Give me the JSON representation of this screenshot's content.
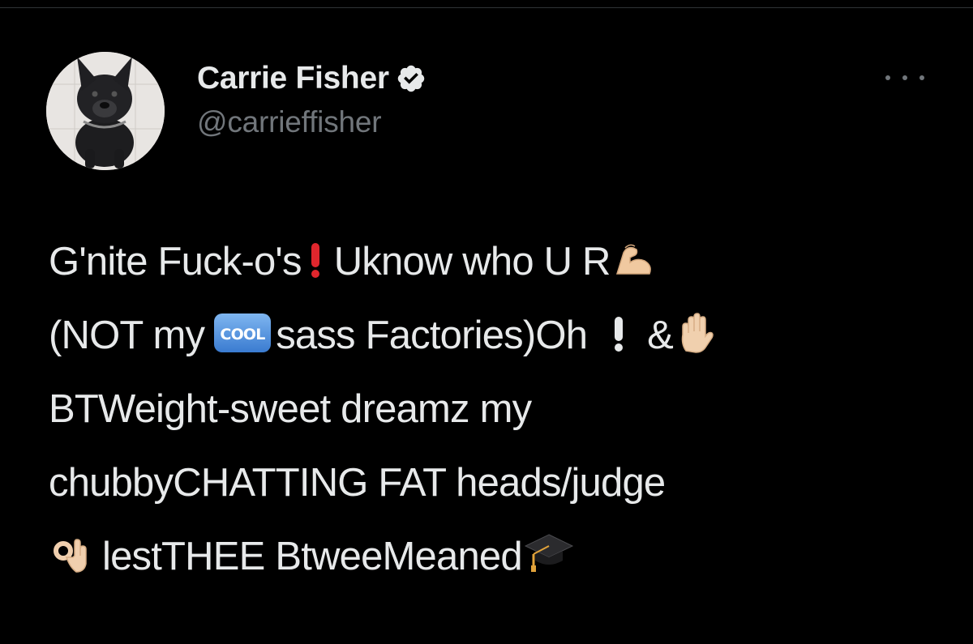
{
  "tweet": {
    "author": {
      "display_name": "Carrie Fisher",
      "handle": "@carrieffisher",
      "verified": true
    },
    "text_segments": {
      "s1": "G'nite Fuck-o's",
      "s2": "Uknow who U R",
      "s3": "(NOT my",
      "s4": "sass Factories)Oh",
      "s5": "&",
      "s6": "BTWeight-sweet dreamz my",
      "s7": "chubbyCHATTING FAT heads/judge",
      "s8": "lestTHEE BtweeMeaned"
    },
    "emoji_cool_label": "COOL",
    "icons": {
      "verified": "verified-badge-icon",
      "more": "more-options-icon",
      "exclamation": "red-exclamation-emoji",
      "white_exclamation": "white-exclamation-emoji",
      "flexed_biceps": "flexed-biceps-emoji",
      "cool": "cool-button-emoji",
      "raised_hand": "raised-hand-emoji",
      "ok_hand": "ok-hand-emoji",
      "graduation_cap": "graduation-cap-emoji"
    },
    "colors": {
      "background": "#000000",
      "text": "#e7e9ea",
      "secondary": "#71767b",
      "exclamation_red": "#e0262d",
      "cool_blue": "#4a90e2"
    }
  }
}
